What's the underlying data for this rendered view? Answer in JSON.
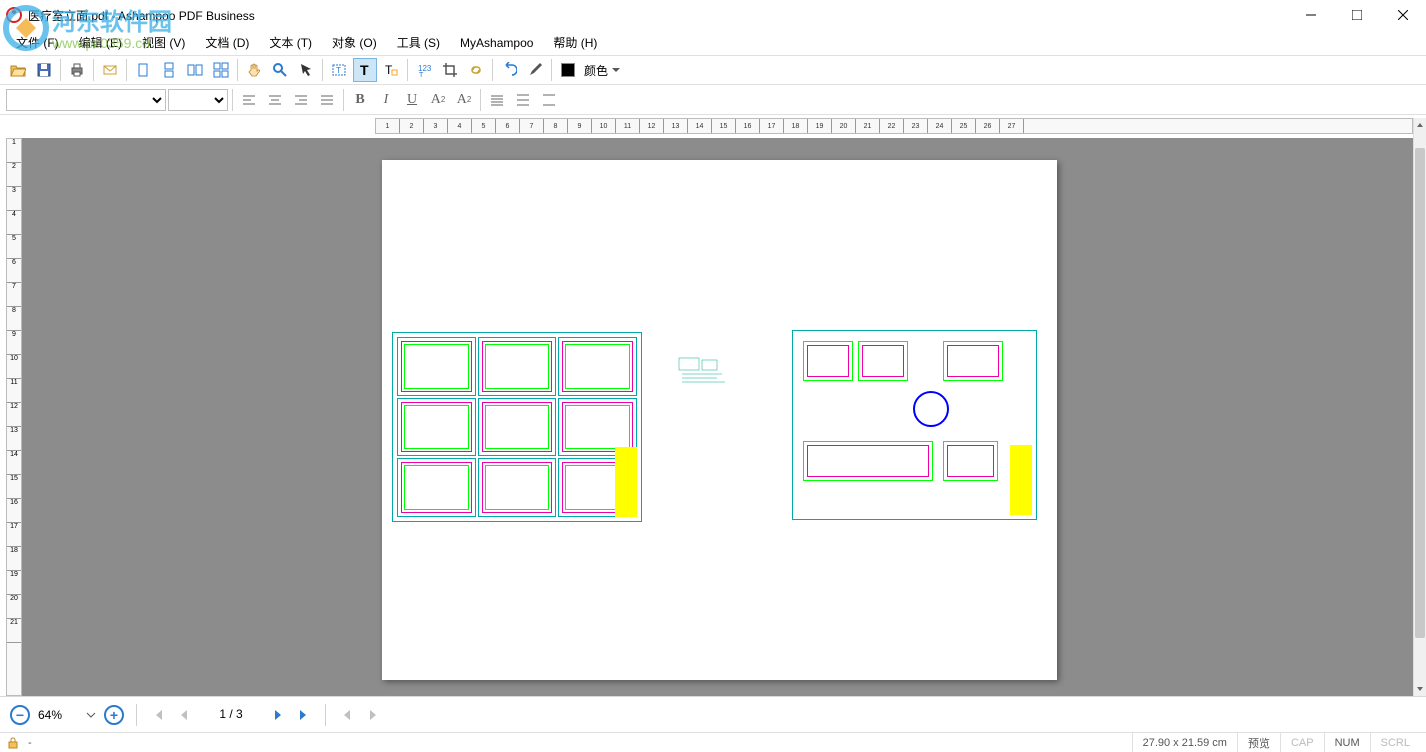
{
  "app": {
    "title": "医疗室立面.pdf - Ashampoo PDF Business"
  },
  "menu": {
    "file": "文件 (F)",
    "edit": "编辑 (E)",
    "view": "视图 (V)",
    "document": "文档 (D)",
    "text": "文本 (T)",
    "object": "对象 (O)",
    "tools": "工具 (S)",
    "myashampoo": "MyAshampoo",
    "help": "帮助 (H)"
  },
  "toolbar": {
    "color_label": "颜色"
  },
  "nav": {
    "zoom": "64%",
    "page": "1 / 3"
  },
  "status": {
    "dash": "-",
    "dims": "27.90 x 21.59 cm",
    "preview": "预览",
    "cap": "CAP",
    "num": "NUM",
    "scrl": "SCRL"
  },
  "watermark": {
    "line1": "河东软件园",
    "url": "www.pc0359.cn"
  },
  "ruler_h_max": 27,
  "ruler_v_max": 21
}
